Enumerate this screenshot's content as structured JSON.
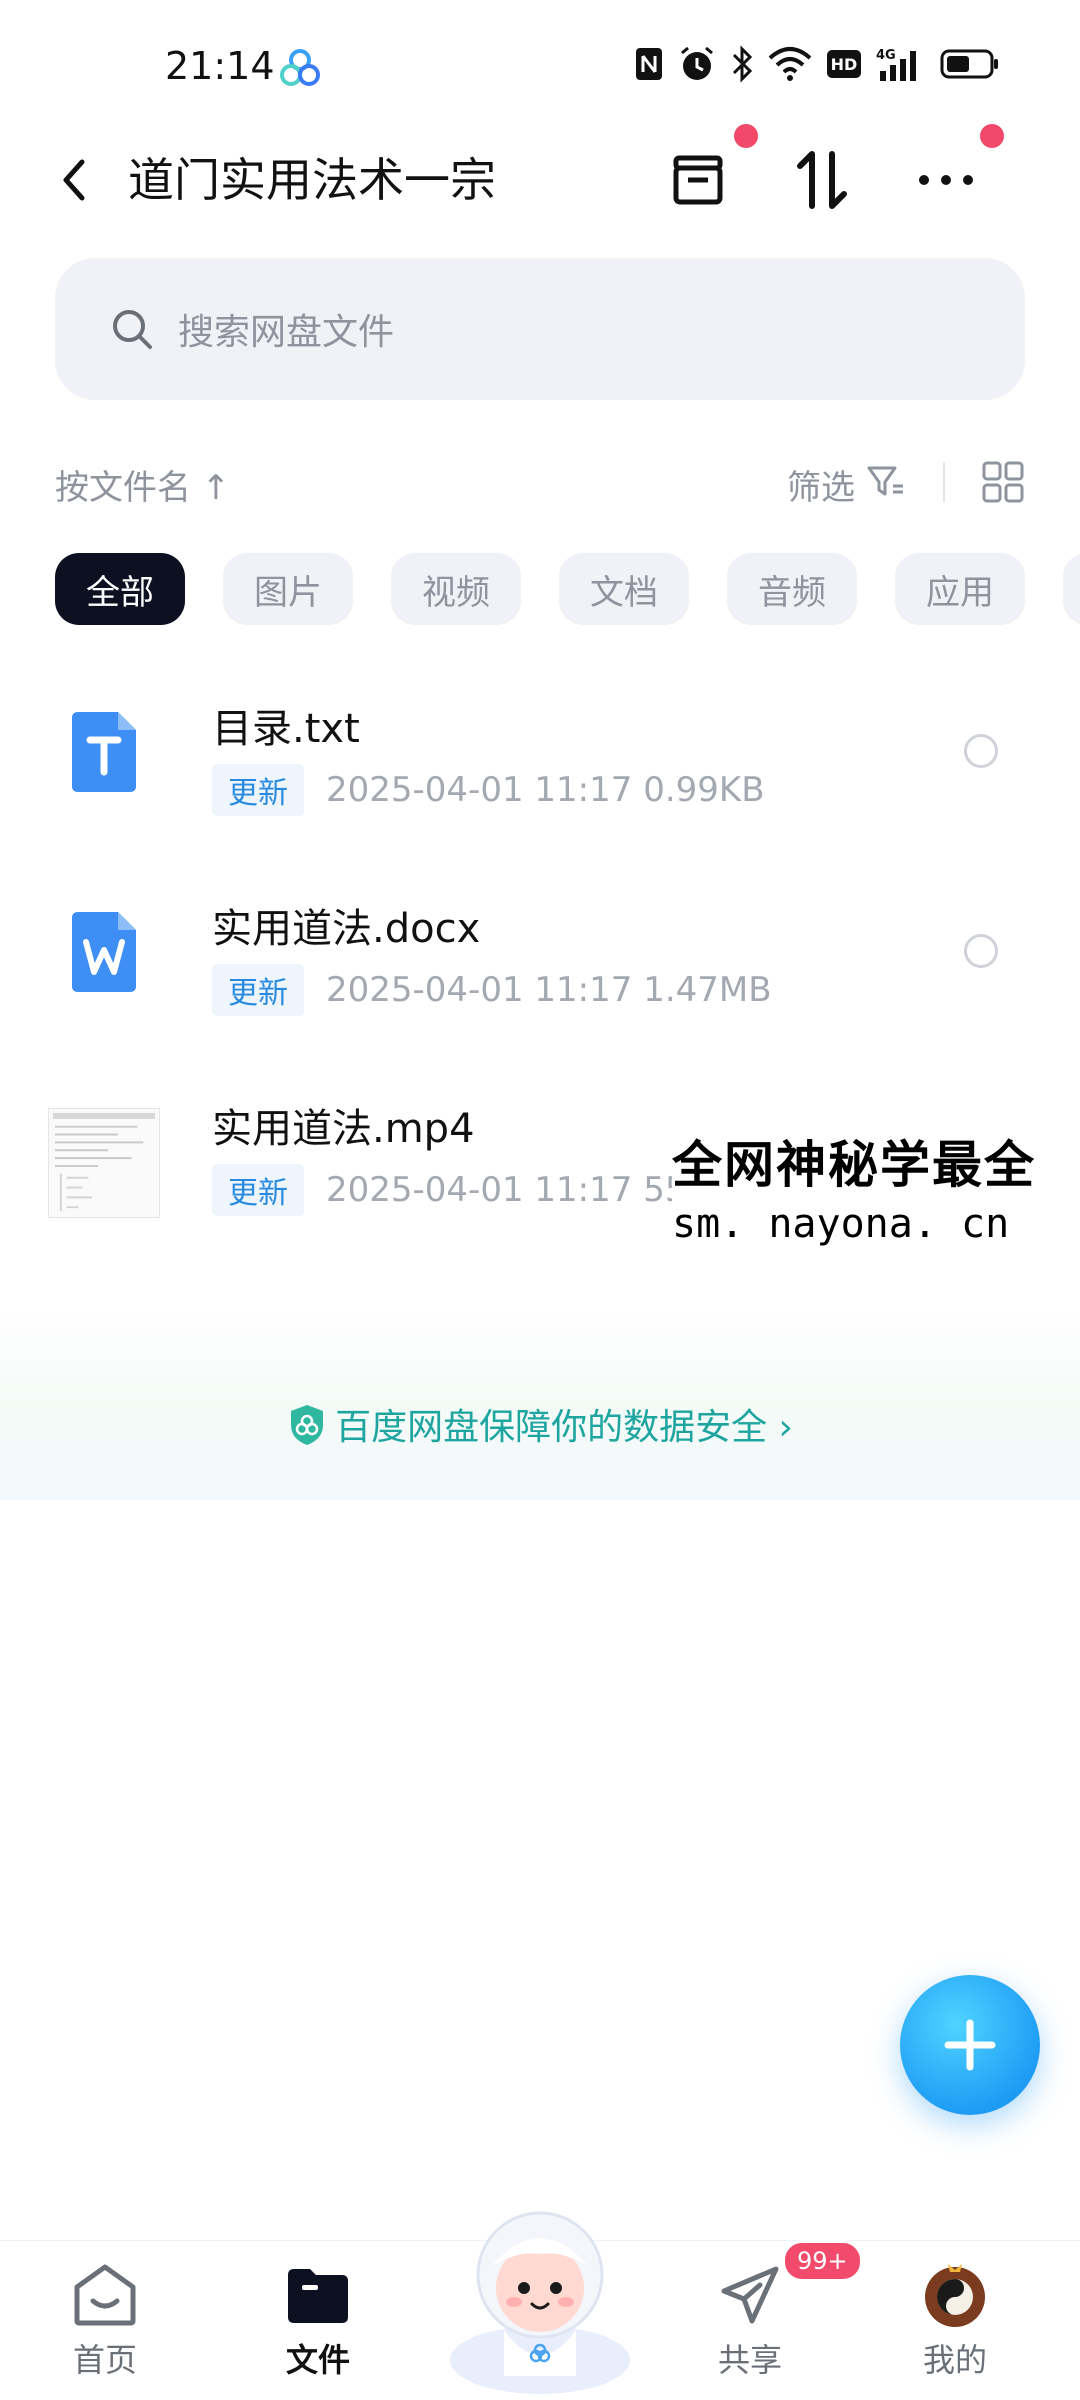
{
  "status_bar": {
    "time": "21:14",
    "icons": [
      "nfc-icon",
      "alarm-icon",
      "bluetooth-icon",
      "wifi-icon",
      "hd-icon",
      "4g-signal-icon",
      "battery-icon"
    ]
  },
  "header": {
    "title": "道门实用法术一宗"
  },
  "search": {
    "placeholder": "搜索网盘文件"
  },
  "sort_row": {
    "sort_label": "按文件名 ↑",
    "filter_label": "筛选"
  },
  "categories": [
    {
      "label": "全部",
      "active": true
    },
    {
      "label": "图片",
      "active": false
    },
    {
      "label": "视频",
      "active": false
    },
    {
      "label": "文档",
      "active": false
    },
    {
      "label": "音频",
      "active": false
    },
    {
      "label": "应用",
      "active": false
    }
  ],
  "files": [
    {
      "name": "目录.txt",
      "badge": "更新",
      "info": "2025-04-01  11:17  0.99KB",
      "type": "txt"
    },
    {
      "name": "实用道法.docx",
      "badge": "更新",
      "info": "2025-04-01  11:17  1.47MB",
      "type": "docx"
    },
    {
      "name": "实用道法.mp4",
      "badge": "更新",
      "info": "2025-04-01  11:17  55",
      "type": "mp4"
    }
  ],
  "watermark": {
    "line1": "全网神秘学最全",
    "line2": "sm. nayona. cn"
  },
  "security_banner": {
    "text": "百度网盘保障你的数据安全 ›"
  },
  "bottom_nav": {
    "home": "首页",
    "files": "文件",
    "share": "共享",
    "share_badge": "99+",
    "mine": "我的"
  },
  "colors": {
    "accent": "#1f9df5",
    "teal": "#1fa5a0",
    "red_dot": "#f2496b",
    "chip_active_bg": "#0d1020"
  }
}
